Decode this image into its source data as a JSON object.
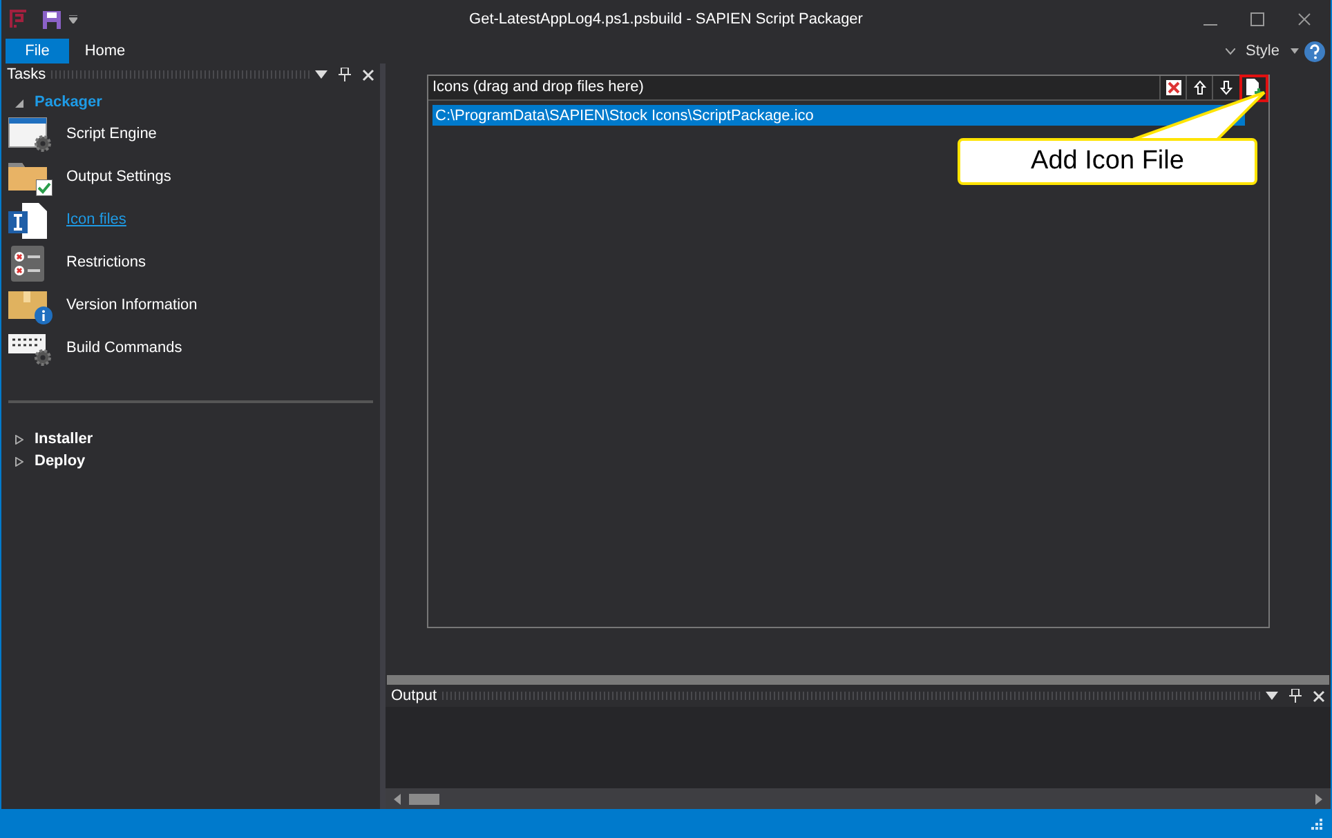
{
  "window": {
    "title": "Get-LatestAppLog4.ps1.psbuild - SAPIEN Script Packager"
  },
  "ribbon_tabs": [
    {
      "label": "File",
      "selected": true
    },
    {
      "label": "Home",
      "selected": false
    }
  ],
  "style_menu": {
    "label": "Style"
  },
  "tasks_panel": {
    "title": "Tasks",
    "groups": [
      {
        "label": "Packager",
        "expanded": true,
        "items": [
          {
            "label": "Script Engine",
            "kind": "engine",
            "selected": false
          },
          {
            "label": "Output Settings",
            "kind": "folder",
            "selected": false
          },
          {
            "label": "Icon files",
            "kind": "iconfile",
            "selected": true
          },
          {
            "label": "Restrictions",
            "kind": "restrictions",
            "selected": false
          },
          {
            "label": "Version Information",
            "kind": "version",
            "selected": false
          },
          {
            "label": "Build Commands",
            "kind": "build",
            "selected": false
          }
        ]
      },
      {
        "label": "Installer",
        "expanded": false
      },
      {
        "label": "Deploy",
        "expanded": false
      }
    ]
  },
  "icons_list": {
    "header": "Icons (drag and drop files here)",
    "rows": [
      {
        "path": "C:\\ProgramData\\SAPIEN\\Stock Icons\\ScriptPackage.ico",
        "selected": true
      }
    ],
    "callout": "Add Icon File"
  },
  "output_panel": {
    "title": "Output"
  }
}
